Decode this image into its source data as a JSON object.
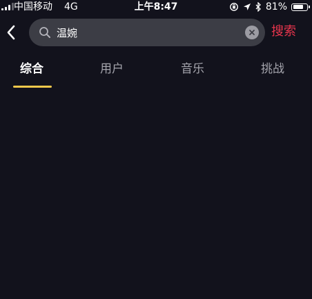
{
  "status_bar": {
    "carrier": "中国移动",
    "network": "4G",
    "time": "上午8:47",
    "battery_percent": "81%",
    "battery_level": 0.81
  },
  "search": {
    "query": "温婉",
    "submit_label": "搜索"
  },
  "tabs": [
    {
      "label": "综合",
      "active": true
    },
    {
      "label": "用户",
      "active": false
    },
    {
      "label": "音乐",
      "active": false
    },
    {
      "label": "挑战",
      "active": false
    }
  ],
  "colors": {
    "background": "#12121c",
    "search_box": "#3c3d45",
    "accent_red": "#e8354d",
    "tab_indicator": "#f5c94c",
    "inactive_tab": "#a5a5ad"
  }
}
